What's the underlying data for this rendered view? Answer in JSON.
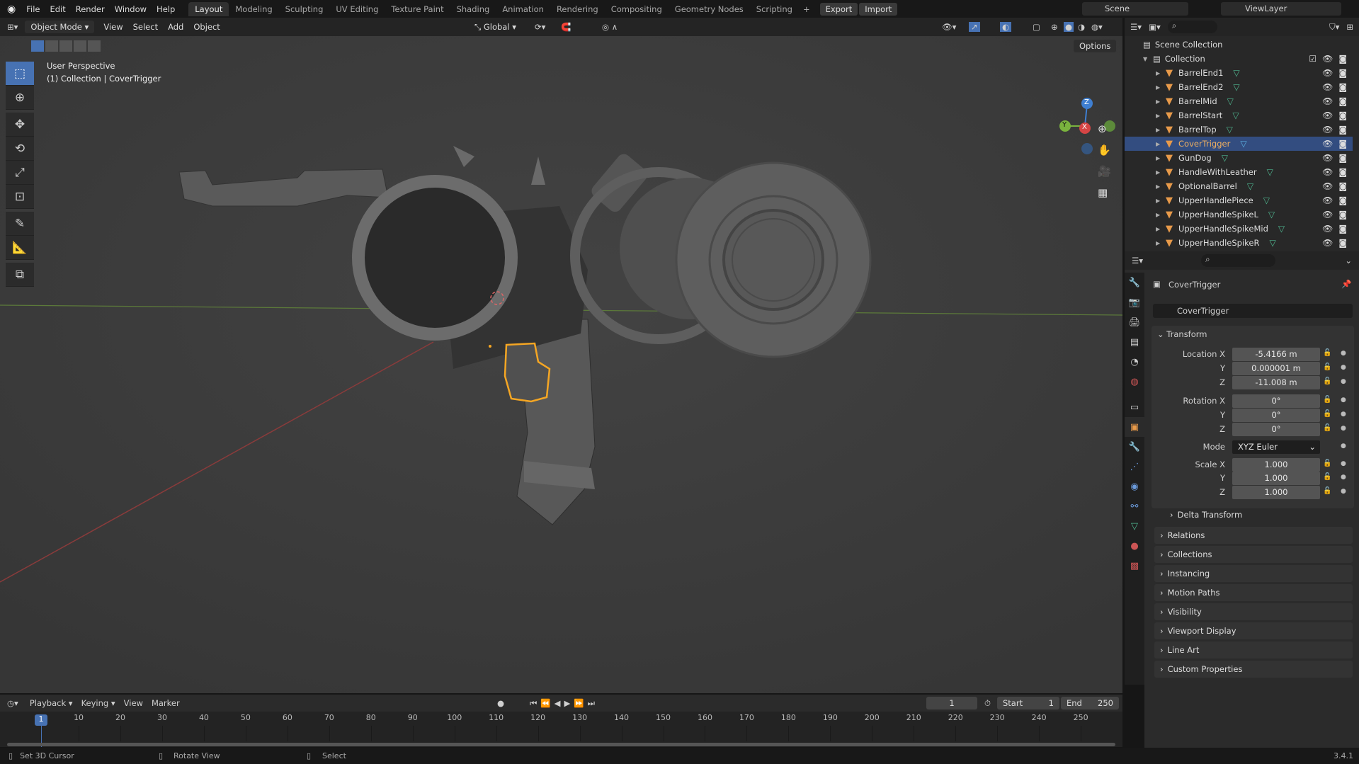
{
  "topbar": {
    "menus": [
      "File",
      "Edit",
      "Render",
      "Window",
      "Help"
    ],
    "workspaces": [
      "Layout",
      "Modeling",
      "Sculpting",
      "UV Editing",
      "Texture Paint",
      "Shading",
      "Animation",
      "Rendering",
      "Compositing",
      "Geometry Nodes",
      "Scripting"
    ],
    "active_workspace": "Layout",
    "add_label": "+",
    "export_label": "Export",
    "import_label": "Import",
    "scene": "Scene",
    "view_layer": "ViewLayer"
  },
  "viewport_header": {
    "mode": "Object Mode",
    "menus": [
      "View",
      "Select",
      "Add",
      "Object"
    ],
    "orientation": "Global",
    "options_label": "Options"
  },
  "viewport": {
    "view_name": "User Perspective",
    "context": "(1) Collection | CoverTrigger",
    "tools": [
      "select-box",
      "cursor",
      "move",
      "rotate",
      "scale",
      "transform",
      "annotate",
      "measure",
      "add-cube"
    ],
    "gizmo": {
      "x": "X",
      "y": "Y",
      "z": "Z"
    },
    "colors": {
      "selection": "#f5a623",
      "x_axis": "#d64545",
      "y_axis": "#7ab33e",
      "z_axis": "#3f7fd1"
    }
  },
  "outliner": {
    "scene_collection": "Scene Collection",
    "collection": "Collection",
    "items": [
      "BarrelEnd1",
      "BarrelEnd2",
      "BarrelMid",
      "BarrelStart",
      "BarrelTop",
      "CoverTrigger",
      "GunDog",
      "HandleWithLeather",
      "OptionalBarrel",
      "UpperHandlePiece",
      "UpperHandleSpikeL",
      "UpperHandleSpikeMid",
      "UpperHandleSpikeR"
    ],
    "selected": "CoverTrigger"
  },
  "properties": {
    "object_name": "CoverTrigger",
    "name_field": "CoverTrigger",
    "transform_label": "Transform",
    "location": {
      "label": "Location X",
      "x": "-5.4166 m",
      "y": "0.000001 m",
      "z": "-11.008 m"
    },
    "rotation": {
      "label": "Rotation X",
      "x": "0°",
      "y": "0°",
      "z": "0°"
    },
    "mode": {
      "label": "Mode",
      "value": "XYZ Euler"
    },
    "scale": {
      "label": "Scale X",
      "x": "1.000",
      "y": "1.000",
      "z": "1.000"
    },
    "axis_y": "Y",
    "axis_z": "Z",
    "sections": [
      "Delta Transform",
      "Relations",
      "Collections",
      "Instancing",
      "Motion Paths",
      "Visibility",
      "Viewport Display",
      "Line Art",
      "Custom Properties"
    ]
  },
  "timeline": {
    "menus": [
      "Playback",
      "Keying",
      "View",
      "Marker"
    ],
    "current_frame": "1",
    "start_label": "Start",
    "start": "1",
    "end_label": "End",
    "end": "250",
    "ticks": [
      "10",
      "20",
      "30",
      "40",
      "50",
      "60",
      "70",
      "80",
      "90",
      "100",
      "110",
      "120",
      "130",
      "140",
      "150",
      "160",
      "170",
      "180",
      "190",
      "200",
      "210",
      "220",
      "230",
      "240",
      "250"
    ]
  },
  "status": {
    "left": "Set 3D Cursor",
    "middle": "Rotate View",
    "right": "Select",
    "version": "3.4.1"
  }
}
